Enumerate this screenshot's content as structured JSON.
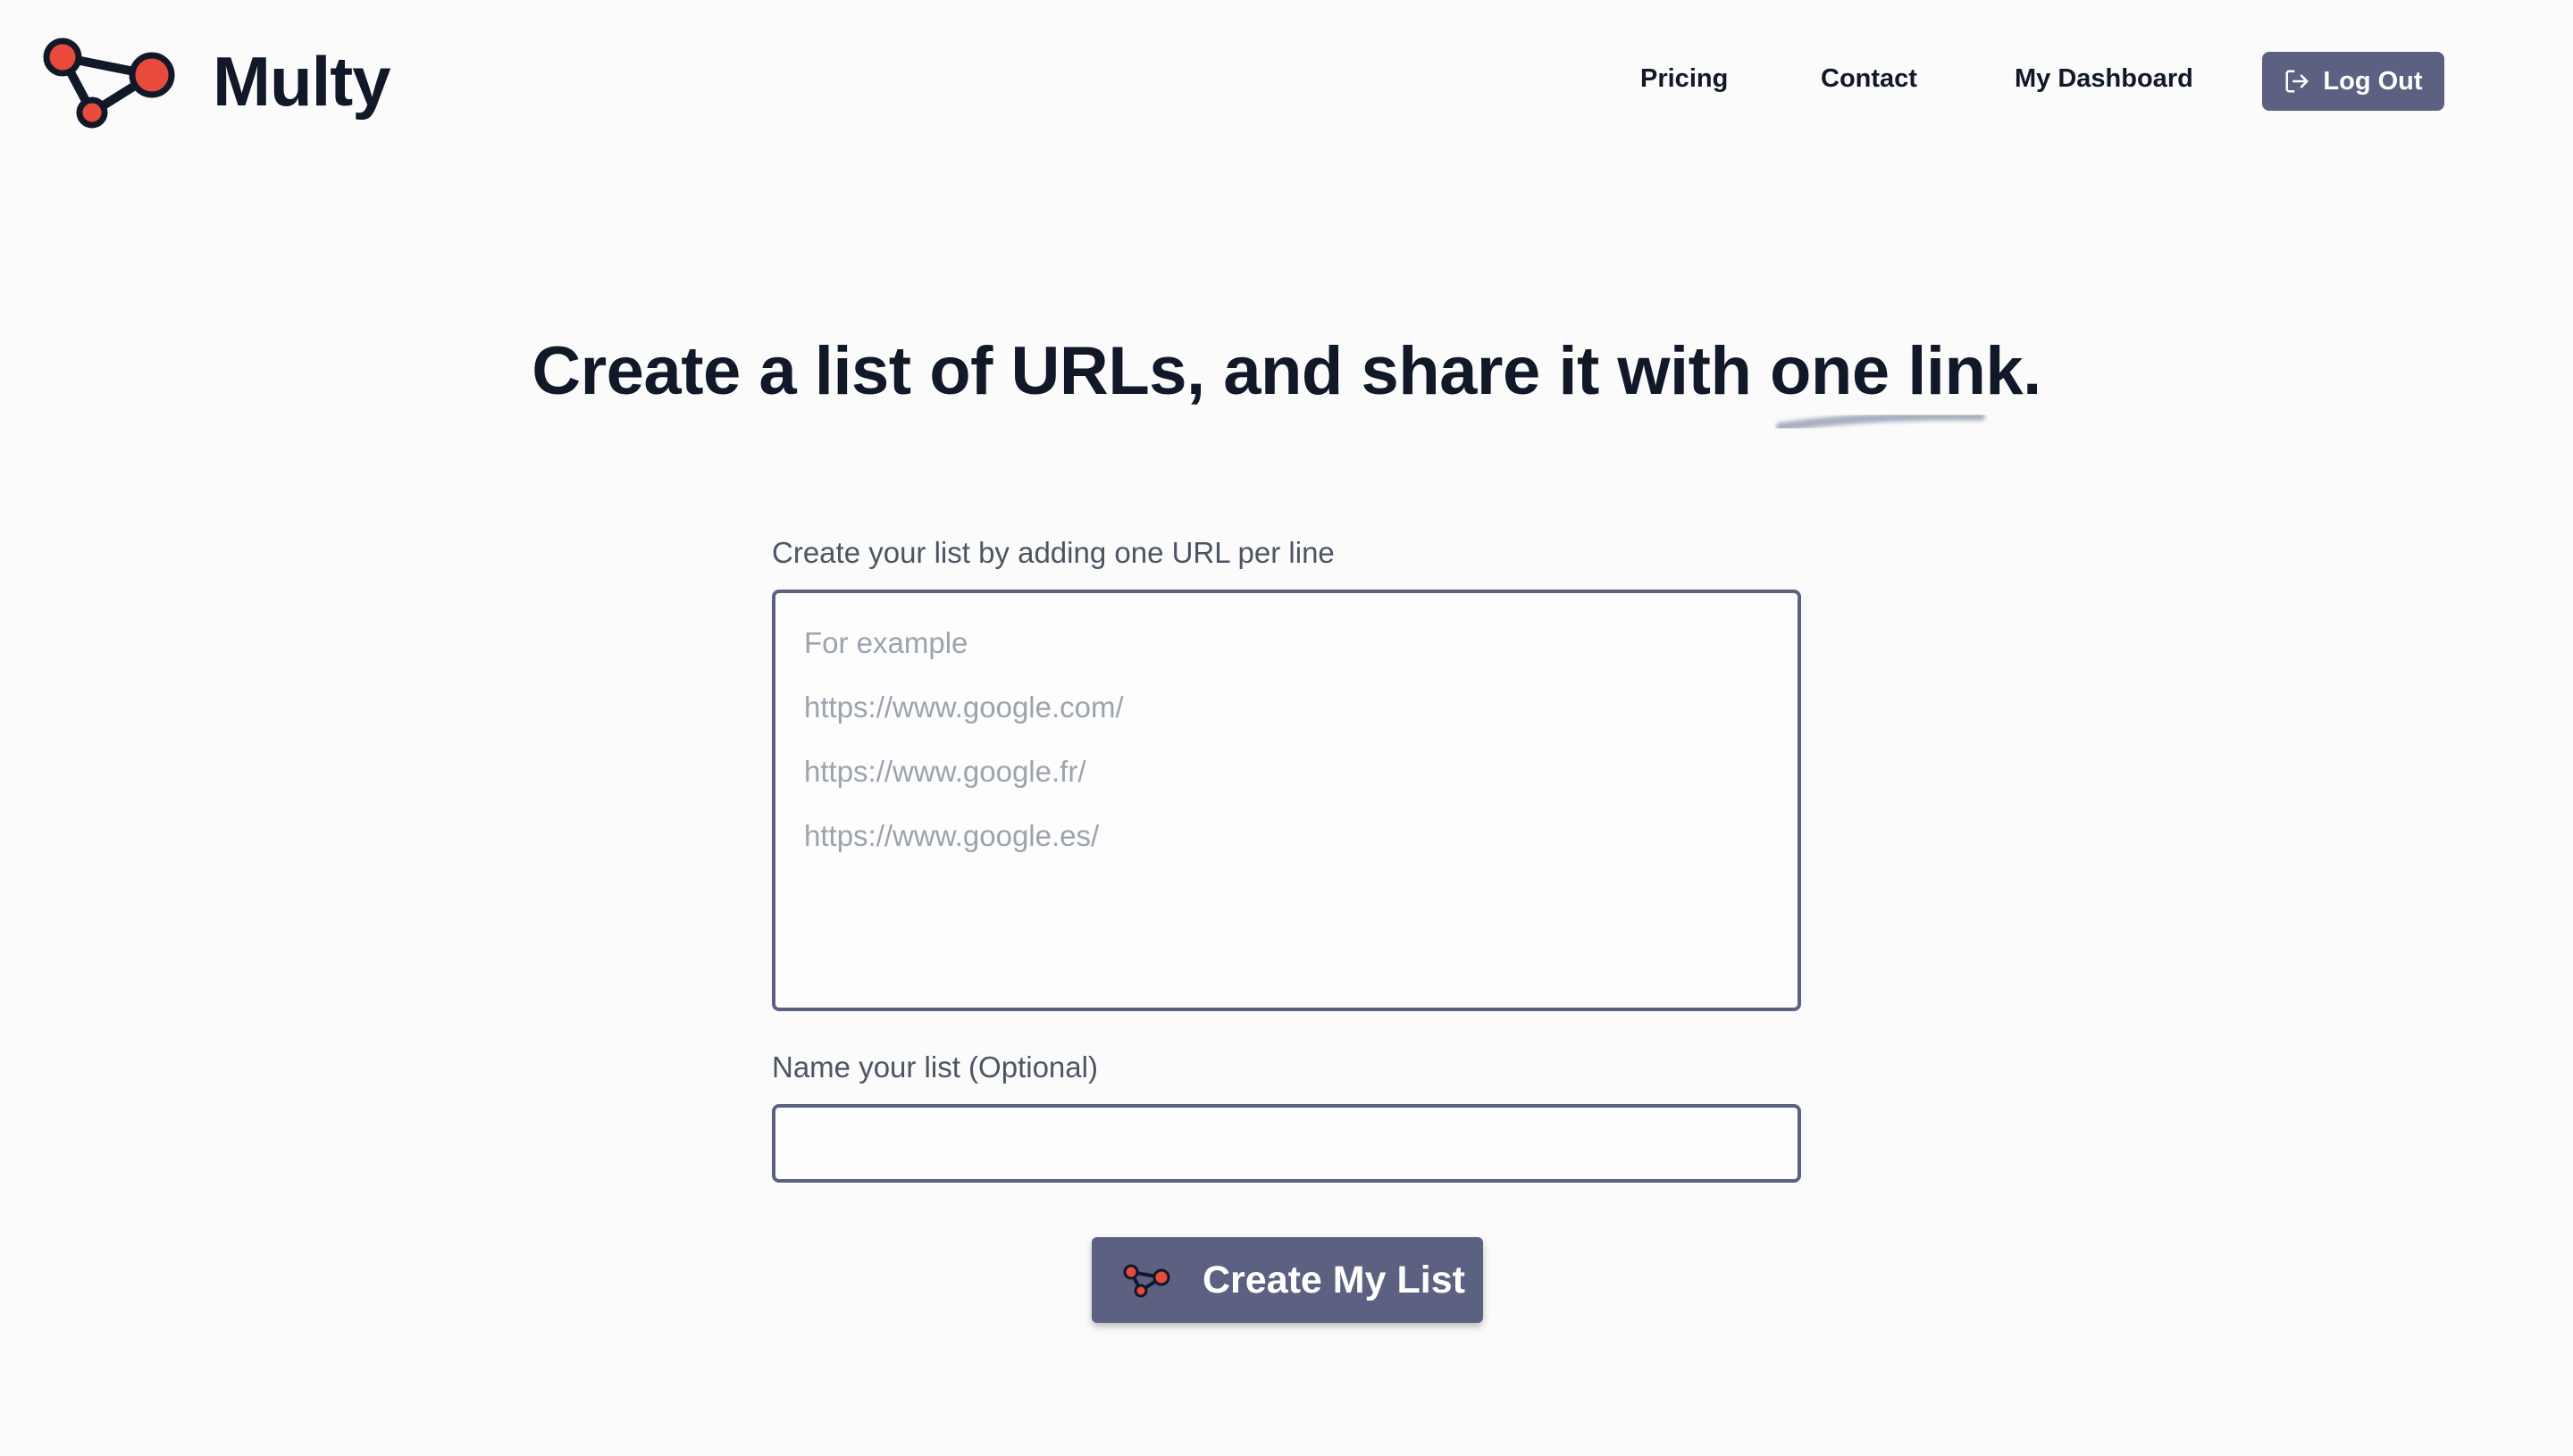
{
  "brand": {
    "name": "Multy",
    "accent_color": "#e84a3c",
    "dark_color": "#111827",
    "button_color": "#5d6181"
  },
  "nav": {
    "links": [
      "Pricing",
      "Contact",
      "My Dashboard"
    ],
    "logout_label": "Log Out"
  },
  "hero": {
    "title": "Create a list of URLs, and share it with one link."
  },
  "form": {
    "urls_label": "Create your list by adding one URL per line",
    "urls_placeholder_lines": [
      "For example",
      "https://www.google.com/",
      "https://www.google.fr/",
      "https://www.google.es/"
    ],
    "name_label": "Name your list (Optional)",
    "name_value": "",
    "submit_label": "Create My List"
  },
  "icons": {
    "logo": "network-nodes-icon",
    "logout": "log-out-icon",
    "submit": "network-nodes-icon"
  }
}
